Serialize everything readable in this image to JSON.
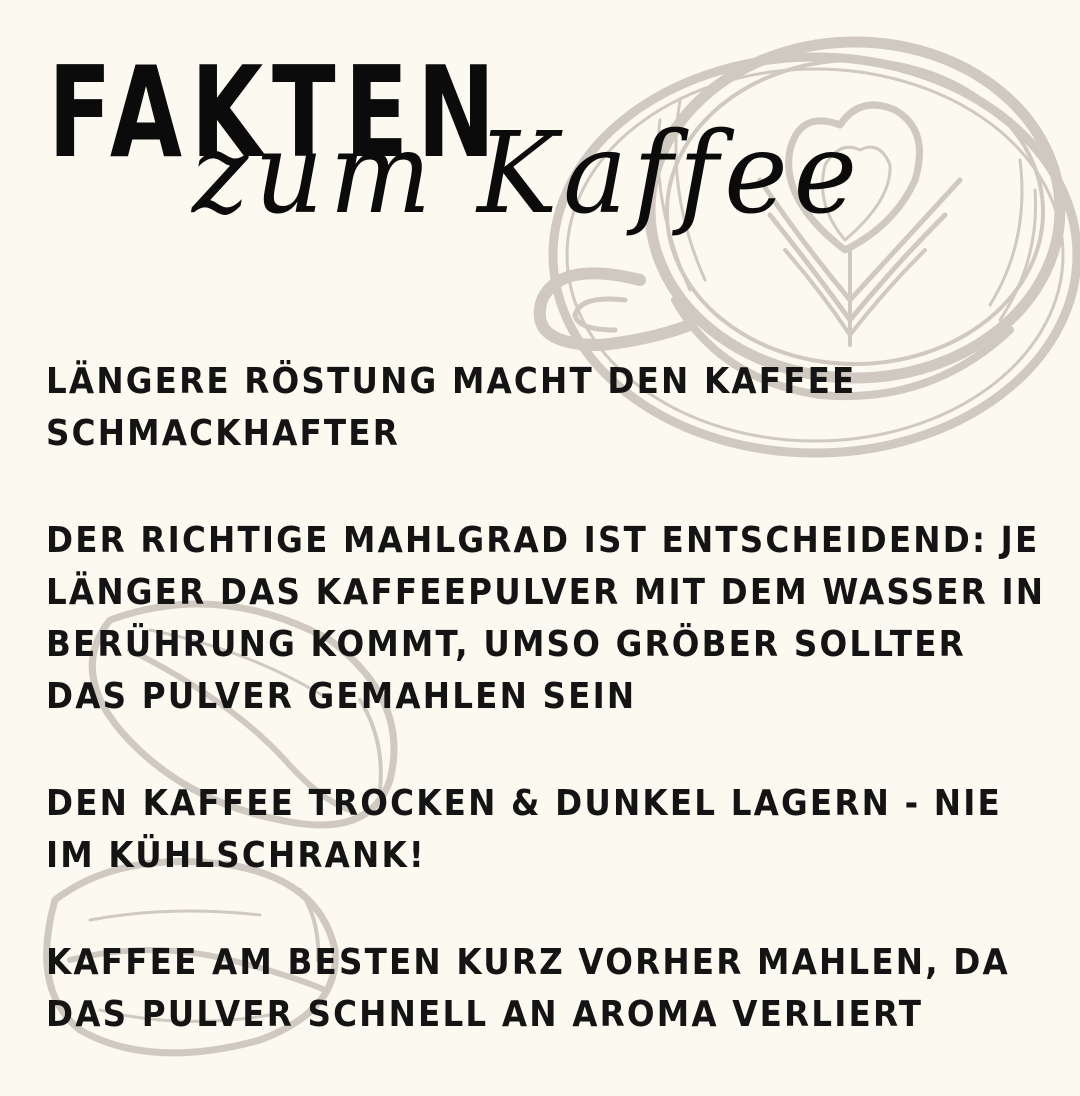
{
  "header": {
    "title": "FAKTEN",
    "subtitle": "zum Kaffee"
  },
  "facts": [
    "LÄNGERE RÖSTUNG MACHT DEN KAFFEE SCHMACKHAFTER",
    "DER RICHTIGE MAHLGRAD IST ENTSCHEIDEND: JE LÄNGER DAS KAFFEEPULVER MIT DEM WASSER IN BERÜHRUNG KOMMT, UMSO GRÖBER SOLLTER DAS PULVER GEMAHLEN SEIN",
    "DEN KAFFEE TROCKEN & DUNKEL LAGERN - NIE IM KÜHLSCHRANK!",
    "KAFFEE AM BESTEN KURZ VORHER MAHLEN, DA DAS PULVER SCHNELL AN AROMA VERLIERT"
  ],
  "illustrations": [
    "coffee-cup-illustration",
    "coffee-bean-illustration"
  ],
  "colors": {
    "background": "#fcf9f1",
    "text": "#141414",
    "illustration": "#cfc9c1"
  }
}
